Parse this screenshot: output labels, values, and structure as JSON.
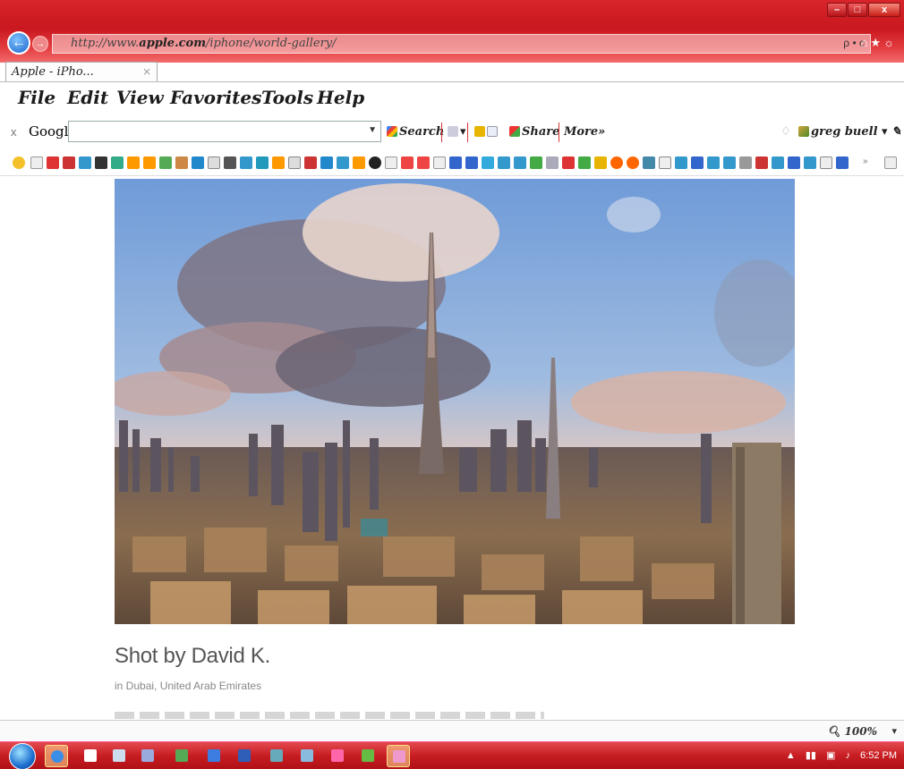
{
  "browser": {
    "address_prefix": "http://www.",
    "address_domain": "apple.com",
    "address_path": "/iphone/world-gallery/",
    "address_right": "ρ • c",
    "tab_label": "Apple - iPho...",
    "tab_close": "×"
  },
  "menu": {
    "items": [
      "File",
      "Edit",
      "View",
      "Favorites",
      "Tools",
      "Help"
    ]
  },
  "google_toolbar": {
    "close": "x",
    "logo": "Google",
    "search_label": "Search",
    "share_label": "Share",
    "more_label": "More»",
    "user_label": "greg buell"
  },
  "page": {
    "caption_title": "Shot by David K.",
    "caption_location": "in Dubai, United Arab Emirates"
  },
  "status": {
    "zoom": "100%"
  },
  "taskbar": {
    "time": "6:52 PM"
  },
  "colors": {
    "chrome_red": "#c9181f",
    "caption_gray": "#555555"
  }
}
